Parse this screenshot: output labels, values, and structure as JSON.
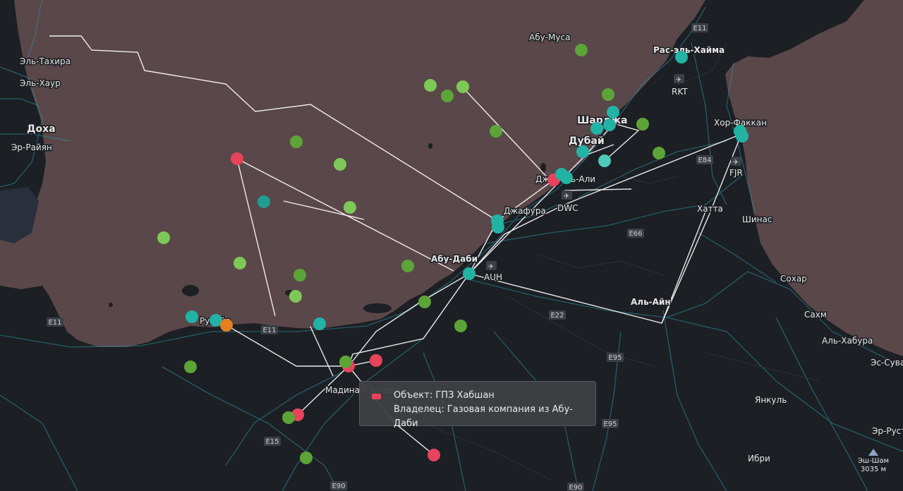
{
  "colors": {
    "land": "#1c1f24",
    "sea": "#5a4749",
    "gas_processing": "#e8435d",
    "field_light": "#7ec857",
    "field_dark": "#5ca438",
    "terminal": "#22b3a4",
    "terminal_light": "#4fc9b7",
    "orange": "#e57f1f",
    "pipeline": "#ffffff",
    "road": "#2f8fa2"
  },
  "places": [
    {
      "name": "Абу-Муса"
    },
    {
      "name": "Эль-Тахира"
    },
    {
      "name": "Эль-Хаур"
    },
    {
      "name": "Доха"
    },
    {
      "name": "Эр-Райян"
    },
    {
      "name": "Рас-эль-Хайма"
    },
    {
      "name": "Шарджа"
    },
    {
      "name": "Дубай"
    },
    {
      "name": "Хор-Факкан"
    },
    {
      "name": "Джебель-Али"
    },
    {
      "name": "Джафура"
    },
    {
      "name": "Хатта"
    },
    {
      "name": "Шинас"
    },
    {
      "name": "Абу-Даби"
    },
    {
      "name": "Сохар"
    },
    {
      "name": "Аль-Айн"
    },
    {
      "name": "Сахм"
    },
    {
      "name": "Аль-Хабура"
    },
    {
      "name": "Эс-Сувайк"
    },
    {
      "name": "Мадинат-Зайед"
    },
    {
      "name": "Рувайс"
    },
    {
      "name": "Янкуль"
    },
    {
      "name": "Эр-Рустак"
    },
    {
      "name": "Ибри"
    }
  ],
  "roads": [
    "E11",
    "E11",
    "E11",
    "E84",
    "E66",
    "E22",
    "E95",
    "E95",
    "E15",
    "E90",
    "E90"
  ],
  "airports": [
    "RKT",
    "FJR",
    "DWC",
    "AUH"
  ],
  "brand": {
    "name": "Эш-Шам",
    "elevation": "3035 м"
  },
  "tooltip": {
    "line1": "Объект: ГПЗ Хабшан",
    "line2": "Владелец: Газовая компания из Абу-Даби"
  }
}
